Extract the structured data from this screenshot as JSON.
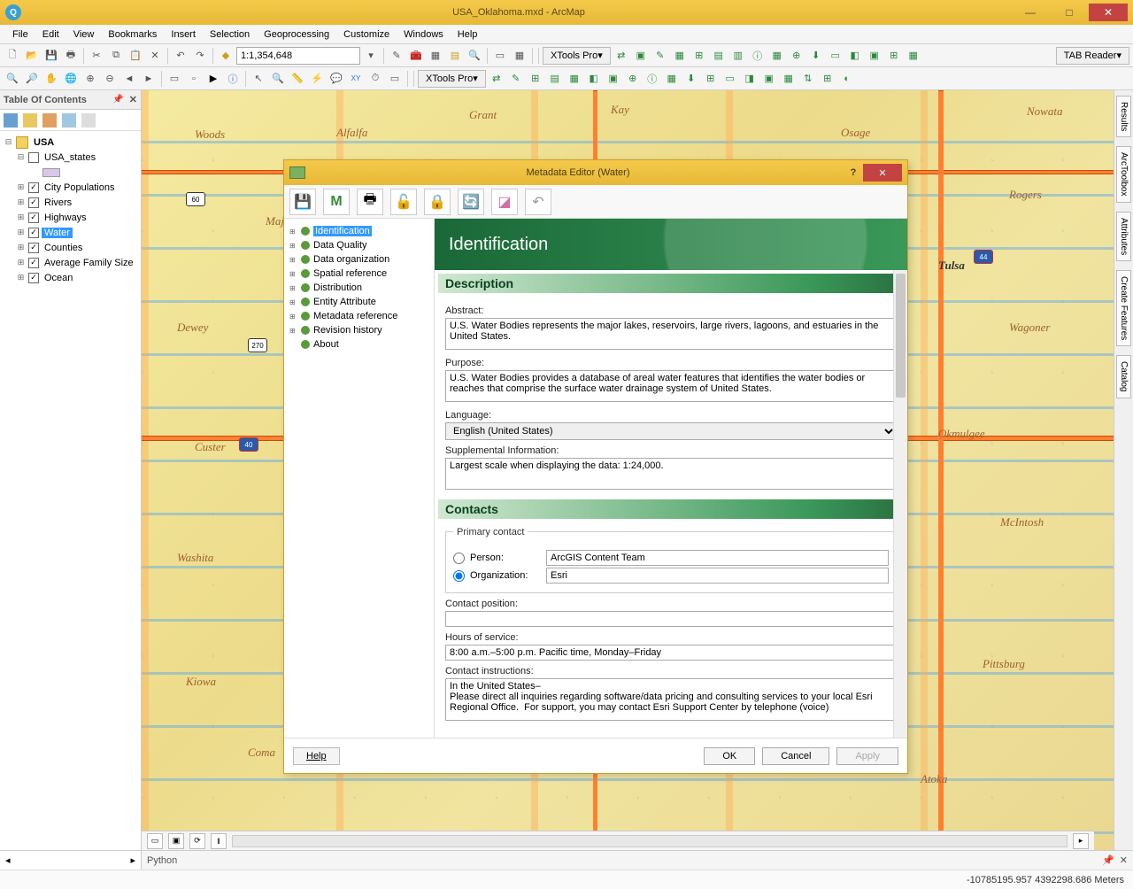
{
  "window": {
    "title": "USA_Oklahoma.mxd - ArcMap"
  },
  "menu": [
    "File",
    "Edit",
    "View",
    "Bookmarks",
    "Insert",
    "Selection",
    "Geoprocessing",
    "Customize",
    "Windows",
    "Help"
  ],
  "scale": "1:1,354,648",
  "xtools_label": "XTools Pro",
  "tab_reader": "TAB Reader",
  "toc": {
    "title": "Table Of Contents",
    "root": "USA",
    "layers": [
      "USA_states",
      "City Populations",
      "Rivers",
      "Highways",
      "Water",
      "Counties",
      "Average Family Size",
      "Ocean"
    ],
    "selected": "Water"
  },
  "dock_tabs": [
    "Results",
    "ArcToolbox",
    "Attributes",
    "Create Features",
    "Catalog"
  ],
  "map_labels": [
    "Woods",
    "Alfalfa",
    "Grant",
    "Kay",
    "Osage",
    "Nowata",
    "Rogers",
    "Tulsa",
    "Wagoner",
    "Okmulgee",
    "McIntosh",
    "Pittsburg",
    "Atoka",
    "Coma",
    "Kiowa",
    "Washita",
    "Custer",
    "Dewey",
    "Majo"
  ],
  "python_tab": "Python",
  "status_coords": "-10785195.957 4392298.686 Meters",
  "dialog": {
    "title": "Metadata Editor (Water)",
    "tree": [
      "Identification",
      "Data Quality",
      "Data organization",
      "Spatial reference",
      "Distribution",
      "Entity Attribute",
      "Metadata reference",
      "Revision history",
      "About"
    ],
    "tree_selected": "Identification",
    "banner": "Identification",
    "sections": {
      "description": "Description",
      "contacts": "Contacts"
    },
    "labels": {
      "abstract": "Abstract:",
      "purpose": "Purpose:",
      "language": "Language:",
      "supplemental": "Supplemental Information:",
      "primary_contact": "Primary contact",
      "person": "Person:",
      "organization": "Organization:",
      "contact_position": "Contact position:",
      "hours": "Hours of service:",
      "instructions": "Contact instructions:"
    },
    "values": {
      "abstract": "U.S. Water Bodies represents the major lakes, reservoirs, large rivers, lagoons, and estuaries in the United States.",
      "purpose": "U.S. Water Bodies provides a database of areal water features that identifies the water bodies or reaches that comprise the surface water drainage system of United States.",
      "language": "English (United States)",
      "supplemental": "Largest scale when displaying the data: 1:24,000.",
      "person": "ArcGIS Content Team",
      "organization": "Esri",
      "contact_position": "",
      "hours": "8:00 a.m.–5:00 p.m. Pacific time, Monday–Friday",
      "instructions": "In the United States–\nPlease direct all inquiries regarding software/data pricing and consulting services to your local Esri Regional Office.  For support, you may contact Esri Support Center by telephone (voice)"
    },
    "buttons": {
      "help": "Help",
      "ok": "OK",
      "cancel": "Cancel",
      "apply": "Apply"
    }
  }
}
